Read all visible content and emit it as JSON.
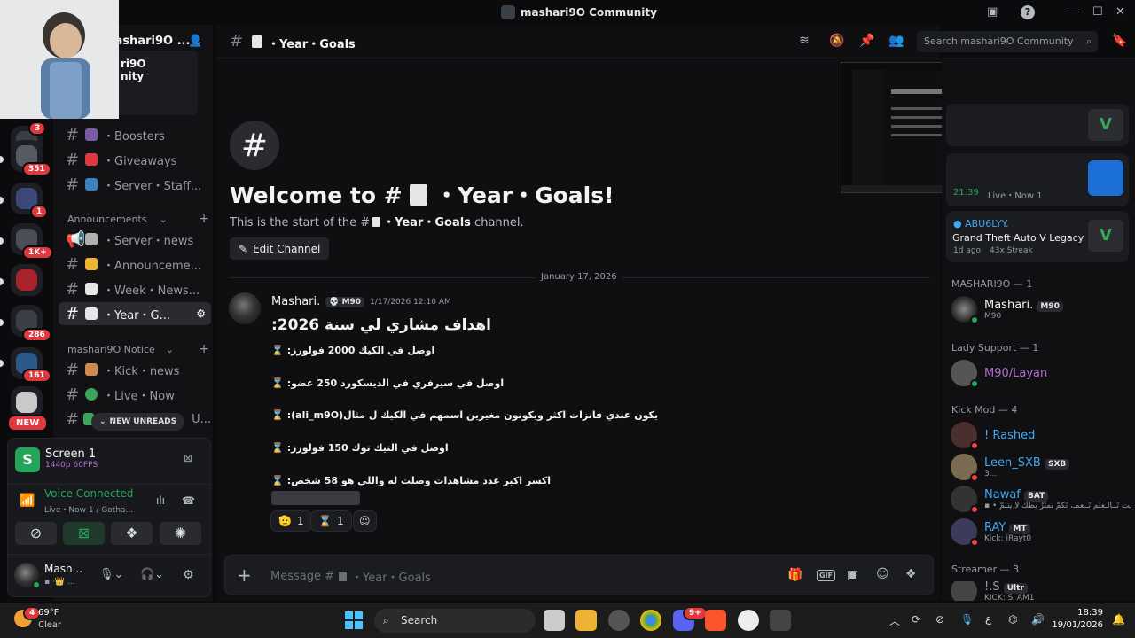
{
  "window": {
    "title": "mashari9O Community"
  },
  "server": {
    "name": "mashari9O ...",
    "popup_lines": [
      "ri9O",
      "nity"
    ]
  },
  "rail_badges": [
    "3",
    "351",
    "1",
    "1K+",
    "286",
    "161",
    "NEW"
  ],
  "channels": [
    {
      "label": "・Boosters",
      "color": "#7b5ba8"
    },
    {
      "label": "・Giveaways",
      "color": "#e0383e"
    },
    {
      "label": "・Server・Staff...",
      "color": "#3b82c4"
    }
  ],
  "announcements": {
    "category": "Announcements",
    "items": [
      {
        "label": "・Server・news",
        "color": "#b0b0b0"
      },
      {
        "label": "・Announceme...",
        "color": "#f0b232"
      },
      {
        "label": "・Week・News...",
        "color": "#e6e6e6"
      },
      {
        "label": "・Year・G...",
        "color": "#e6e6e6",
        "active": true
      }
    ]
  },
  "notice": {
    "category": "mashari9O Notice",
    "items": [
      {
        "label": "・Kick・news",
        "color": "#d08a50"
      },
      {
        "label": "・Live・Now",
        "color": "#3ba55d"
      },
      {
        "label": "U...",
        "color": "#3ba55d"
      }
    ],
    "new_unreads": "NEW UNREADS"
  },
  "stream": {
    "title": "Screen 1",
    "quality": "1440p 60FPS"
  },
  "voice": {
    "status": "Voice Connected",
    "detail": "Live・Now 1 / Gotha..."
  },
  "user": {
    "name": "Mash...",
    "status": "▪ ·👑 ..."
  },
  "header": {
    "channel": "・Year・Goals",
    "search_placeholder": "Search mashari9O Community"
  },
  "welcome": {
    "title_prefix": "Welcome to #",
    "title_suffix": "・Year・Goals!",
    "sub_prefix": "This is the start of the #",
    "sub_channel": "・Year・Goals",
    "sub_suffix": " channel.",
    "edit_label": "Edit Channel"
  },
  "divider_date": "January 17, 2026",
  "message": {
    "author": "Mashari.",
    "tag": "M90",
    "timestamp": "1/17/2026 12:10 AM",
    "title": "اهداف مشاري لي سنة 2026:",
    "lines": [
      "اوصل في الكيك 2000 فولورز:",
      "اوصل في سيرفري في الديسكورد 250 عضو:",
      "يكون عندي فانزات اكثر ويكونون مغيرين اسمهم في الكيك ل مثال(ali_m9O):",
      "اوصل في التيك توك 150 فولورز:",
      "اكسر اكبر عدد مشاهدات وصلت له واللي هو 58 شخص:"
    ],
    "reactions": [
      {
        "emoji": "🫡",
        "count": "1"
      },
      {
        "emoji": "⌛",
        "count": "1"
      }
    ]
  },
  "composer": {
    "placeholder": "Message #",
    "channel": "・Year・Goals"
  },
  "activity": {
    "time": "21:39",
    "live_text": "Live・Now 1",
    "user": "ABU6LYY.",
    "game": "Grand Theft Auto V Legacy",
    "ago": "1d ago",
    "streak": "43x Streak"
  },
  "member_groups": [
    {
      "header": "MASHARI9O — 1",
      "members": [
        {
          "name": "Mashari.",
          "tag": "M90",
          "sub": "M90",
          "color": "#f2f3f5",
          "status": "#23a55a"
        }
      ]
    },
    {
      "header": "Lady Support — 1",
      "members": [
        {
          "name": "M90/Layan",
          "tag": "",
          "sub": "",
          "color": "#b36bd4",
          "status": "#23a55a"
        }
      ]
    },
    {
      "header": "Kick Mod — 4",
      "members": [
        {
          "name": "! Rashed",
          "tag": "",
          "sub": "",
          "color": "#3fa9f5",
          "status": "#f23f43"
        },
        {
          "name": "Leen_SXB",
          "tag": "SXB",
          "sub": "3...",
          "color": "#3fa9f5",
          "status": "#f23f43"
        },
        {
          "name": "Nawaf",
          "tag": "BAT",
          "sub": "▪ • لمت تَــالـعلم تَــعمـ، تَكمَّ تمثَّرُ بطُكُ لا يتلُمّ",
          "color": "#3fa9f5",
          "status": "#f23f43"
        },
        {
          "name": "RAY",
          "tag": "MT",
          "sub": "Kick: iRayt0",
          "color": "#3fa9f5",
          "status": "#f23f43"
        }
      ]
    },
    {
      "header": "Streamer — 3",
      "members": [
        {
          "name": "!.S",
          "tag": "Ultr",
          "sub": "KICK: S_AM1",
          "color": "#949ba4",
          "status": "#23a55a"
        }
      ]
    }
  ],
  "taskbar": {
    "weather_temp": "69°F",
    "weather_desc": "Clear",
    "weather_badge": "4",
    "search": "Search",
    "discord_badge": "9+",
    "time": "18:39",
    "date": "19/01/2026",
    "lang": "ع"
  }
}
